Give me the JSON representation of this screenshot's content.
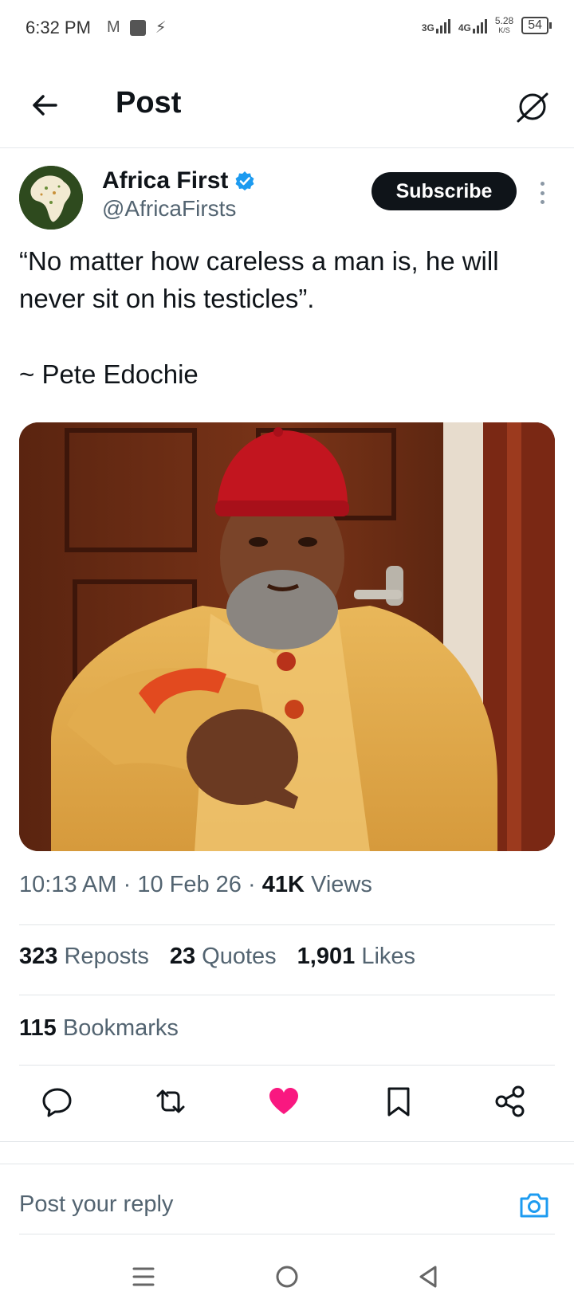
{
  "status_bar": {
    "time": "6:32 PM",
    "network_1": "3G",
    "network_2": "4G",
    "speed_value": "5.28",
    "speed_unit": "K/S",
    "battery": "54"
  },
  "header": {
    "title": "Post"
  },
  "post": {
    "author_name": "Africa First",
    "author_handle": "@AfricaFirsts",
    "subscribe_label": "Subscribe",
    "text": "“No matter how careless a man is, he will never sit on his testicles”.",
    "attribution": "~ Pete Edochie",
    "time": "10:13 AM",
    "date": "10 Feb 26",
    "views_count": "41K",
    "views_label": "Views",
    "separator": "·"
  },
  "stats": {
    "reposts_count": "323",
    "reposts_label": "Reposts",
    "quotes_count": "23",
    "quotes_label": "Quotes",
    "likes_count": "1,901",
    "likes_label": "Likes",
    "bookmarks_count": "115",
    "bookmarks_label": "Bookmarks"
  },
  "actions": {
    "icons": [
      "reply-icon",
      "repost-icon",
      "like-icon",
      "bookmark-icon",
      "share-icon"
    ],
    "like_color": "#f91880"
  },
  "reply": {
    "placeholder": "Post your reply",
    "accent_color": "#1d9bf0"
  },
  "colors": {
    "text_primary": "#0f1419",
    "text_secondary": "#536471",
    "verified": "#1d9bf0"
  }
}
